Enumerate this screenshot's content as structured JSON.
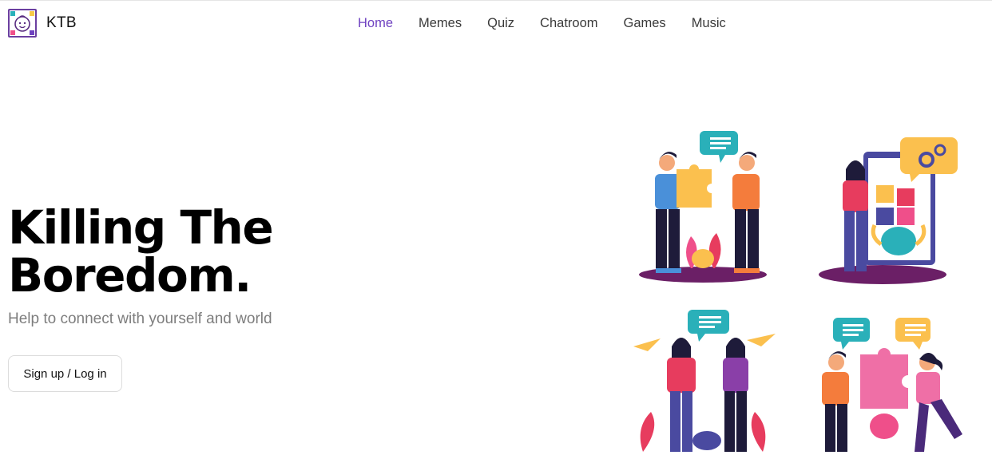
{
  "brand": {
    "name": "KTB",
    "logo_icon": "baby-face-icon"
  },
  "nav": {
    "items": [
      {
        "label": "Home",
        "active": true
      },
      {
        "label": "Memes",
        "active": false
      },
      {
        "label": "Quiz",
        "active": false
      },
      {
        "label": "Chatroom",
        "active": false
      },
      {
        "label": "Games",
        "active": false
      },
      {
        "label": "Music",
        "active": false
      }
    ]
  },
  "hero": {
    "title_line1": "Killing The",
    "title_line2": "Boredom.",
    "subtitle": "Help to connect with yourself and world",
    "cta_label": "Sign up / Log in"
  },
  "colors": {
    "accent": "#6f42c1",
    "text": "#000000",
    "muted": "#7d7d7d",
    "illustration_teal": "#2ab0b9",
    "illustration_yellow": "#fbc04e",
    "illustration_orange": "#f47c3c",
    "illustration_purple": "#6b1f66"
  }
}
